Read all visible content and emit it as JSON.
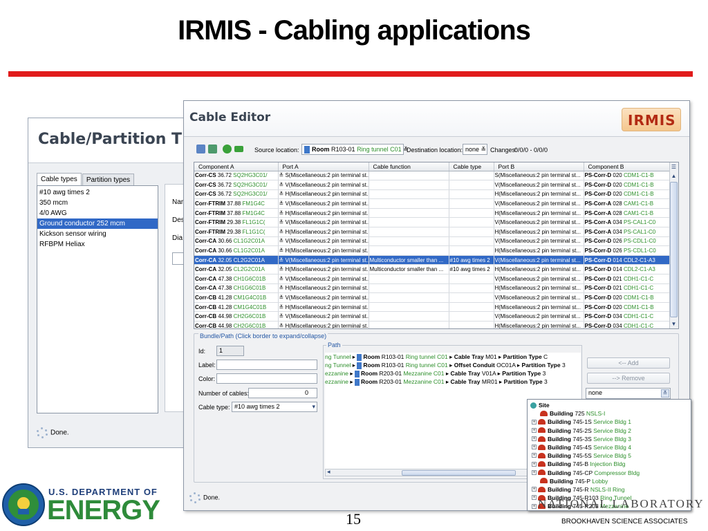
{
  "slide": {
    "title": "IRMIS - Cabling applications",
    "page_number": "15",
    "footer_org": "BROOKHAVEN SCIENCE ASSOCIATES",
    "lab_text": "NATIONAL LABORATORY",
    "doe_line1": "U.S. DEPARTMENT OF",
    "doe_line2": "ENERGY",
    "accent_color": "#e11b1b"
  },
  "partition_window": {
    "title": "Cable/Partition T",
    "tabs": [
      "Cable types",
      "Partition types"
    ],
    "cable_types": [
      "#10 awg times 2",
      "350 mcm",
      "4/0 AWG",
      "Ground conductor 252 mcm",
      "Kickson sensor wiring",
      "RFBPM Heliax"
    ],
    "selected_index": 3,
    "field_labels": [
      "Nar",
      "Des",
      "Dia"
    ],
    "status": "Done."
  },
  "cable_editor": {
    "title": "Cable Editor",
    "logo_text": "IRMIS",
    "toolbar": {
      "source_label": "Source location:",
      "source_room_bold": "Room",
      "source_room_num": "R103-01",
      "source_room_name": "Ring tunnel C01",
      "dest_label": "Destination location:",
      "dest_value": "none",
      "changes_label": "Changes:",
      "changes_value": "0/0/0 - 0/0/0"
    },
    "columns": [
      "Component A",
      "Port A",
      "Cable function",
      "Cable type",
      "Port B",
      "Component B"
    ],
    "rows": [
      {
        "a_bold": "Corr-CS",
        "a_num": "36.72",
        "a_green": "SQ2HG3C01/",
        "port_a": "S(Miscellaneous:2 pin terminal st...",
        "func": "",
        "type": "",
        "port_b": "S(Miscellaneous:2 pin terminal st...",
        "b_bold": "PS-Corr-D",
        "b_num": "020",
        "b_green": "CDM1-C1-B"
      },
      {
        "a_bold": "Corr-CS",
        "a_num": "36.72",
        "a_green": "SQ2HG3C01/",
        "port_a": "V(Miscellaneous:2 pin terminal st...",
        "func": "",
        "type": "",
        "port_b": "V(Miscellaneous:2 pin terminal st...",
        "b_bold": "PS-Corr-D",
        "b_num": "020",
        "b_green": "CDM1-C1-B"
      },
      {
        "a_bold": "Corr-CS",
        "a_num": "36.72",
        "a_green": "SQ2HG3C01/",
        "port_a": "H(Miscellaneous:2 pin terminal st...",
        "func": "",
        "type": "",
        "port_b": "H(Miscellaneous:2 pin terminal st...",
        "b_bold": "PS-Corr-D",
        "b_num": "020",
        "b_green": "CDM1-C1-B"
      },
      {
        "a_bold": "Corr-FTRIM",
        "a_num": "37.88",
        "a_green": "FM1G4C",
        "port_a": "V(Miscellaneous:2 pin terminal st...",
        "func": "",
        "type": "",
        "port_b": "V(Miscellaneous:2 pin terminal st...",
        "b_bold": "PS-Corr-A",
        "b_num": "028",
        "b_green": "CAM1-C1-B"
      },
      {
        "a_bold": "Corr-FTRIM",
        "a_num": "37.88",
        "a_green": "FM1G4C",
        "port_a": "H(Miscellaneous:2 pin terminal st...",
        "func": "",
        "type": "",
        "port_b": "H(Miscellaneous:2 pin terminal st...",
        "b_bold": "PS-Corr-A",
        "b_num": "028",
        "b_green": "CAM1-C1-B"
      },
      {
        "a_bold": "Corr-FTRIM",
        "a_num": "29.38",
        "a_green": "FL1G1C(",
        "port_a": "V(Miscellaneous:2 pin terminal st...",
        "func": "",
        "type": "",
        "port_b": "V(Miscellaneous:2 pin terminal st...",
        "b_bold": "PS-Corr-A",
        "b_num": "034",
        "b_green": "PS-CAL1-C0"
      },
      {
        "a_bold": "Corr-FTRIM",
        "a_num": "29.38",
        "a_green": "FL1G1C(",
        "port_a": "H(Miscellaneous:2 pin terminal st...",
        "func": "",
        "type": "",
        "port_b": "H(Miscellaneous:2 pin terminal st...",
        "b_bold": "PS-Corr-A",
        "b_num": "034",
        "b_green": "PS-CAL1-C0"
      },
      {
        "a_bold": "Corr-CA",
        "a_num": "30.66",
        "a_green": "CL1G2C01A",
        "port_a": "V(Miscellaneous:2 pin terminal st...",
        "func": "",
        "type": "",
        "port_b": "V(Miscellaneous:2 pin terminal st...",
        "b_bold": "PS-Corr-D",
        "b_num": "026",
        "b_green": "PS-CDL1-C0"
      },
      {
        "a_bold": "Corr-CA",
        "a_num": "30.66",
        "a_green": "CL1G2C01A",
        "port_a": "H(Miscellaneous:2 pin terminal st...",
        "func": "",
        "type": "",
        "port_b": "H(Miscellaneous:2 pin terminal st...",
        "b_bold": "PS-Corr-D",
        "b_num": "026",
        "b_green": "PS-CDL1-C0"
      },
      {
        "a_bold": "Corr-CA",
        "a_num": "32.05",
        "a_green": "CL2G2C01A",
        "port_a": "V(Miscellaneous:2 pin terminal st...",
        "func": "Multiconductor smaller than ...",
        "type": "#10 awg times 2",
        "port_b": "V(Miscellaneous:2 pin terminal st...",
        "b_bold": "PS-Corr-D",
        "b_num": "014",
        "b_green": "CDL2-C1-A3",
        "selected": true
      },
      {
        "a_bold": "Corr-CA",
        "a_num": "32.05",
        "a_green": "CL2G2C01A",
        "port_a": "H(Miscellaneous:2 pin terminal st...",
        "func": "Multiconductor smaller than ...",
        "type": "#10 awg times 2",
        "port_b": "H(Miscellaneous:2 pin terminal st...",
        "b_bold": "PS-Corr-D",
        "b_num": "014",
        "b_green": "CDL2-C1-A3"
      },
      {
        "a_bold": "Corr-CA",
        "a_num": "47.38",
        "a_green": "CH1G6C01B",
        "port_a": "V(Miscellaneous:2 pin terminal st...",
        "func": "",
        "type": "",
        "port_b": "V(Miscellaneous:2 pin terminal st...",
        "b_bold": "PS-Corr-D",
        "b_num": "021",
        "b_green": "CDH1-C1-C"
      },
      {
        "a_bold": "Corr-CA",
        "a_num": "47.38",
        "a_green": "CH1G6C01B",
        "port_a": "H(Miscellaneous:2 pin terminal st...",
        "func": "",
        "type": "",
        "port_b": "H(Miscellaneous:2 pin terminal st...",
        "b_bold": "PS-Corr-D",
        "b_num": "021",
        "b_green": "CDH1-C1-C"
      },
      {
        "a_bold": "Corr-CB",
        "a_num": "41.28",
        "a_green": "CM1G4C01B",
        "port_a": "V(Miscellaneous:2 pin terminal st...",
        "func": "",
        "type": "",
        "port_b": "V(Miscellaneous:2 pin terminal st...",
        "b_bold": "PS-Corr-D",
        "b_num": "020",
        "b_green": "CDM1-C1-B"
      },
      {
        "a_bold": "Corr-CB",
        "a_num": "41.28",
        "a_green": "CM1G4C01B",
        "port_a": "H(Miscellaneous:2 pin terminal st...",
        "func": "",
        "type": "",
        "port_b": "H(Miscellaneous:2 pin terminal st...",
        "b_bold": "PS-Corr-D",
        "b_num": "020",
        "b_green": "CDM1-C1-B"
      },
      {
        "a_bold": "Corr-CB",
        "a_num": "44.98",
        "a_green": "CH2G6C01B",
        "port_a": "V(Miscellaneous:2 pin terminal st...",
        "func": "",
        "type": "",
        "port_b": "V(Miscellaneous:2 pin terminal st...",
        "b_bold": "PS-Corr-D",
        "b_num": "034",
        "b_green": "CDH1-C1-C"
      },
      {
        "a_bold": "Corr-CB",
        "a_num": "44.98",
        "a_green": "CH2G6C01B",
        "port_a": "H(Miscellaneous:2 pin terminal st...",
        "func": "",
        "type": "",
        "port_b": "H(Miscellaneous:2 pin terminal st...",
        "b_bold": "PS-Corr-D",
        "b_num": "034",
        "b_green": "CDH1-C1-C"
      }
    ],
    "bundle": {
      "legend": "Bundle/Path (Click border to expand/collapse)",
      "id_label": "Id:",
      "id_value": "1",
      "label_label": "Label:",
      "color_label": "Color:",
      "num_cables_label": "Number of cables:",
      "num_cables_value": "0",
      "cable_type_label": "Cable type:",
      "cable_type_value": "#10 awg times 2",
      "path_legend": "Path",
      "path_rows": [
        {
          "lead": "ng Tunnel",
          "room_num": "R103-01",
          "room_name": "Ring tunnel C01",
          "item_bold": "Cable Tray",
          "item_id": "M01",
          "pt_value": "C"
        },
        {
          "lead": "ng Tunnel",
          "room_num": "R103-01",
          "room_name": "Ring tunnel C01",
          "item_bold": "Offset Conduit",
          "item_id": "OC01A",
          "pt_value": "3"
        },
        {
          "lead": "ezzanine",
          "room_num": "R203-01",
          "room_name": "Mezzanine C01",
          "item_bold": "Cable Tray",
          "item_id": "V01A",
          "pt_value": "3"
        },
        {
          "lead": "ezzanine",
          "room_num": "R203-01",
          "room_name": "Mezzanine C01",
          "item_bold": "Cable Tray",
          "item_id": "MR01",
          "pt_value": "3"
        }
      ],
      "room_word": "Room",
      "partition_word": "Partition Type",
      "add_button": "<-- Add",
      "remove_button": "--> Remove",
      "location_value": "none"
    },
    "status": "Done."
  },
  "location_tree": {
    "root": "Site",
    "building_word": "Building",
    "items": [
      {
        "num": "725",
        "name": "NSLS-I",
        "expand": false
      },
      {
        "num": "745-1S",
        "name": "Service Bldg 1",
        "expand": true
      },
      {
        "num": "745-2S",
        "name": "Service Bldg 2",
        "expand": true
      },
      {
        "num": "745-3S",
        "name": "Service Bldg 3",
        "expand": true
      },
      {
        "num": "745-4S",
        "name": "Service Bldg 4",
        "expand": true
      },
      {
        "num": "745-5S",
        "name": "Service Bldg 5",
        "expand": true
      },
      {
        "num": "745-B",
        "name": "Injection Bldg",
        "expand": true
      },
      {
        "num": "745-CP",
        "name": "Compressor Bldg",
        "expand": true
      },
      {
        "num": "745-P",
        "name": "Lobby",
        "expand": false
      },
      {
        "num": "745-R",
        "name": "NSLS-II Ring",
        "expand": true
      },
      {
        "num": "745-R103",
        "name": "Ring Tunnel",
        "expand": true
      },
      {
        "num": "745-R203",
        "name": "Mezzanine",
        "expand": true
      }
    ]
  }
}
